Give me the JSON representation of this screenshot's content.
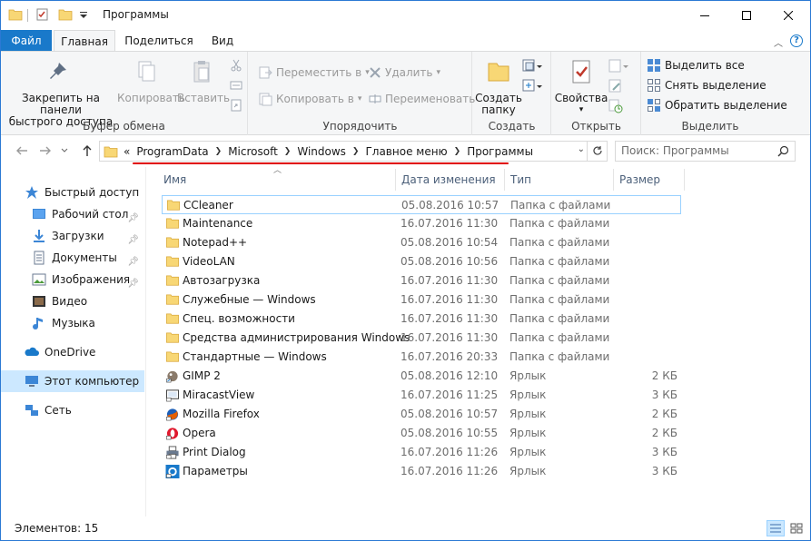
{
  "window": {
    "title": "Программы",
    "accent_color": "#1979ca"
  },
  "ribbon_tabs": {
    "file": "Файл",
    "home": "Главная",
    "share": "Поделиться",
    "view": "Вид"
  },
  "clipboard": {
    "pin_label_1": "Закрепить на панели",
    "pin_label_2": "быстрого доступа",
    "copy": "Копировать",
    "paste": "Вставить",
    "group": "Буфер обмена"
  },
  "organize": {
    "move_to": "Переместить в",
    "copy_to": "Копировать в",
    "delete": "Удалить",
    "rename": "Переименовать",
    "group": "Упорядочить"
  },
  "create": {
    "new_folder_1": "Создать",
    "new_folder_2": "папку",
    "group": "Создать"
  },
  "open": {
    "properties": "Свойства",
    "group": "Открыть"
  },
  "select": {
    "select_all": "Выделить все",
    "select_none": "Снять выделение",
    "invert": "Обратить выделение",
    "group": "Выделить"
  },
  "address": {
    "overflow": "«",
    "crumbs": [
      "ProgramData",
      "Microsoft",
      "Windows",
      "Главное меню",
      "Программы"
    ]
  },
  "search": {
    "placeholder": "Поиск: Программы"
  },
  "nav": {
    "quick_access": "Быстрый доступ",
    "desktop": "Рабочий стол",
    "downloads": "Загрузки",
    "documents": "Документы",
    "pictures": "Изображения",
    "video": "Видео",
    "music": "Музыка",
    "onedrive": "OneDrive",
    "this_pc": "Этот компьютер",
    "network": "Сеть"
  },
  "columns": {
    "name": "Имя",
    "date": "Дата изменения",
    "type": "Тип",
    "size": "Размер"
  },
  "files": [
    {
      "name": "CCleaner",
      "date": "05.08.2016 10:57",
      "type": "Папка с файлами",
      "size": "",
      "icon": "folder-icon"
    },
    {
      "name": "Maintenance",
      "date": "16.07.2016 11:30",
      "type": "Папка с файлами",
      "size": "",
      "icon": "folder-icon"
    },
    {
      "name": "Notepad++",
      "date": "05.08.2016 10:54",
      "type": "Папка с файлами",
      "size": "",
      "icon": "folder-icon"
    },
    {
      "name": "VideoLAN",
      "date": "05.08.2016 10:56",
      "type": "Папка с файлами",
      "size": "",
      "icon": "folder-icon"
    },
    {
      "name": "Автозагрузка",
      "date": "16.07.2016 11:30",
      "type": "Папка с файлами",
      "size": "",
      "icon": "folder-icon"
    },
    {
      "name": "Служебные — Windows",
      "date": "16.07.2016 11:30",
      "type": "Папка с файлами",
      "size": "",
      "icon": "folder-icon"
    },
    {
      "name": "Спец. возможности",
      "date": "16.07.2016 11:30",
      "type": "Папка с файлами",
      "size": "",
      "icon": "folder-icon"
    },
    {
      "name": "Средства администрирования Windows",
      "date": "16.07.2016 11:30",
      "type": "Папка с файлами",
      "size": "",
      "icon": "folder-icon"
    },
    {
      "name": "Стандартные — Windows",
      "date": "16.07.2016 20:33",
      "type": "Папка с файлами",
      "size": "",
      "icon": "folder-icon"
    },
    {
      "name": "GIMP 2",
      "date": "05.08.2016 12:10",
      "type": "Ярлык",
      "size": "2 КБ",
      "icon": "gimp-icon"
    },
    {
      "name": "MiracastView",
      "date": "16.07.2016 11:25",
      "type": "Ярлык",
      "size": "3 КБ",
      "icon": "miracast-icon"
    },
    {
      "name": "Mozilla Firefox",
      "date": "05.08.2016 10:57",
      "type": "Ярлык",
      "size": "2 КБ",
      "icon": "firefox-icon"
    },
    {
      "name": "Opera",
      "date": "05.08.2016 10:55",
      "type": "Ярлык",
      "size": "2 КБ",
      "icon": "opera-icon"
    },
    {
      "name": "Print Dialog",
      "date": "16.07.2016 11:26",
      "type": "Ярлык",
      "size": "3 КБ",
      "icon": "printer-icon"
    },
    {
      "name": "Параметры",
      "date": "16.07.2016 11:26",
      "type": "Ярлык",
      "size": "3 КБ",
      "icon": "settings-icon"
    }
  ],
  "status": {
    "items_count": "Элементов: 15"
  }
}
